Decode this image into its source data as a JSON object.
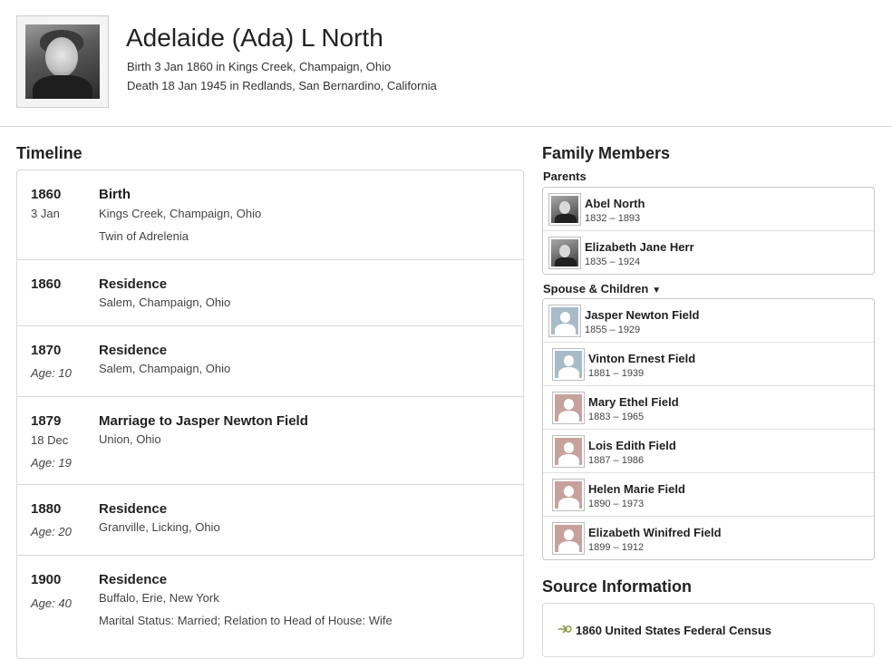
{
  "person": {
    "name": "Adelaide (Ada) L North",
    "birth": "Birth 3 Jan 1860 in Kings Creek, Champaign, Ohio",
    "death": "Death 18 Jan 1945 in Redlands, San Bernardino, California"
  },
  "timeline": {
    "title": "Timeline",
    "events": [
      {
        "year": "1860",
        "date": "3 Jan",
        "title": "Birth",
        "place": "Kings Creek, Champaign, Ohio",
        "note": "Twin of Adrelenia"
      },
      {
        "year": "1860",
        "title": "Residence",
        "place": "Salem, Champaign, Ohio"
      },
      {
        "year": "1870",
        "age": "Age: 10",
        "title": "Residence",
        "place": "Salem, Champaign, Ohio"
      },
      {
        "year": "1879",
        "date": "18 Dec",
        "age": "Age: 19",
        "title": "Marriage to Jasper Newton Field",
        "place": "Union, Ohio"
      },
      {
        "year": "1880",
        "age": "Age: 20",
        "title": "Residence",
        "place": "Granville, Licking, Ohio"
      },
      {
        "year": "1900",
        "age": "Age: 40",
        "title": "Residence",
        "place": "Buffalo, Erie, New York",
        "note": "Marital Status: Married; Relation to Head of House: Wife"
      }
    ]
  },
  "family": {
    "title": "Family Members",
    "parents_label": "Parents",
    "parents": [
      {
        "name": "Abel North",
        "dates": "1832 – 1893"
      },
      {
        "name": "Elizabeth Jane Herr",
        "dates": "1835 – 1924"
      }
    ],
    "spouse_label": "Spouse & Children",
    "spouse_caret": "▼",
    "spouse": {
      "name": "Jasper Newton Field",
      "dates": "1855 – 1929"
    },
    "children": [
      {
        "name": "Vinton Ernest Field",
        "dates": "1881 – 1939"
      },
      {
        "name": "Mary Ethel Field",
        "dates": "1883 – 1965"
      },
      {
        "name": "Lois Edith Field",
        "dates": "1887 – 1986"
      },
      {
        "name": "Helen Marie Field",
        "dates": "1890 – 1973"
      },
      {
        "name": "Elizabeth Winifred Field",
        "dates": "1899 – 1912"
      }
    ]
  },
  "source": {
    "title": "Source Information",
    "first_item": "1860 United States Federal Census",
    "icon": "source-leaf-icon"
  },
  "colors": {
    "male_placeholder": "#a7bcc8",
    "female_placeholder": "#c7a29d",
    "border": "#d8d8d8"
  }
}
